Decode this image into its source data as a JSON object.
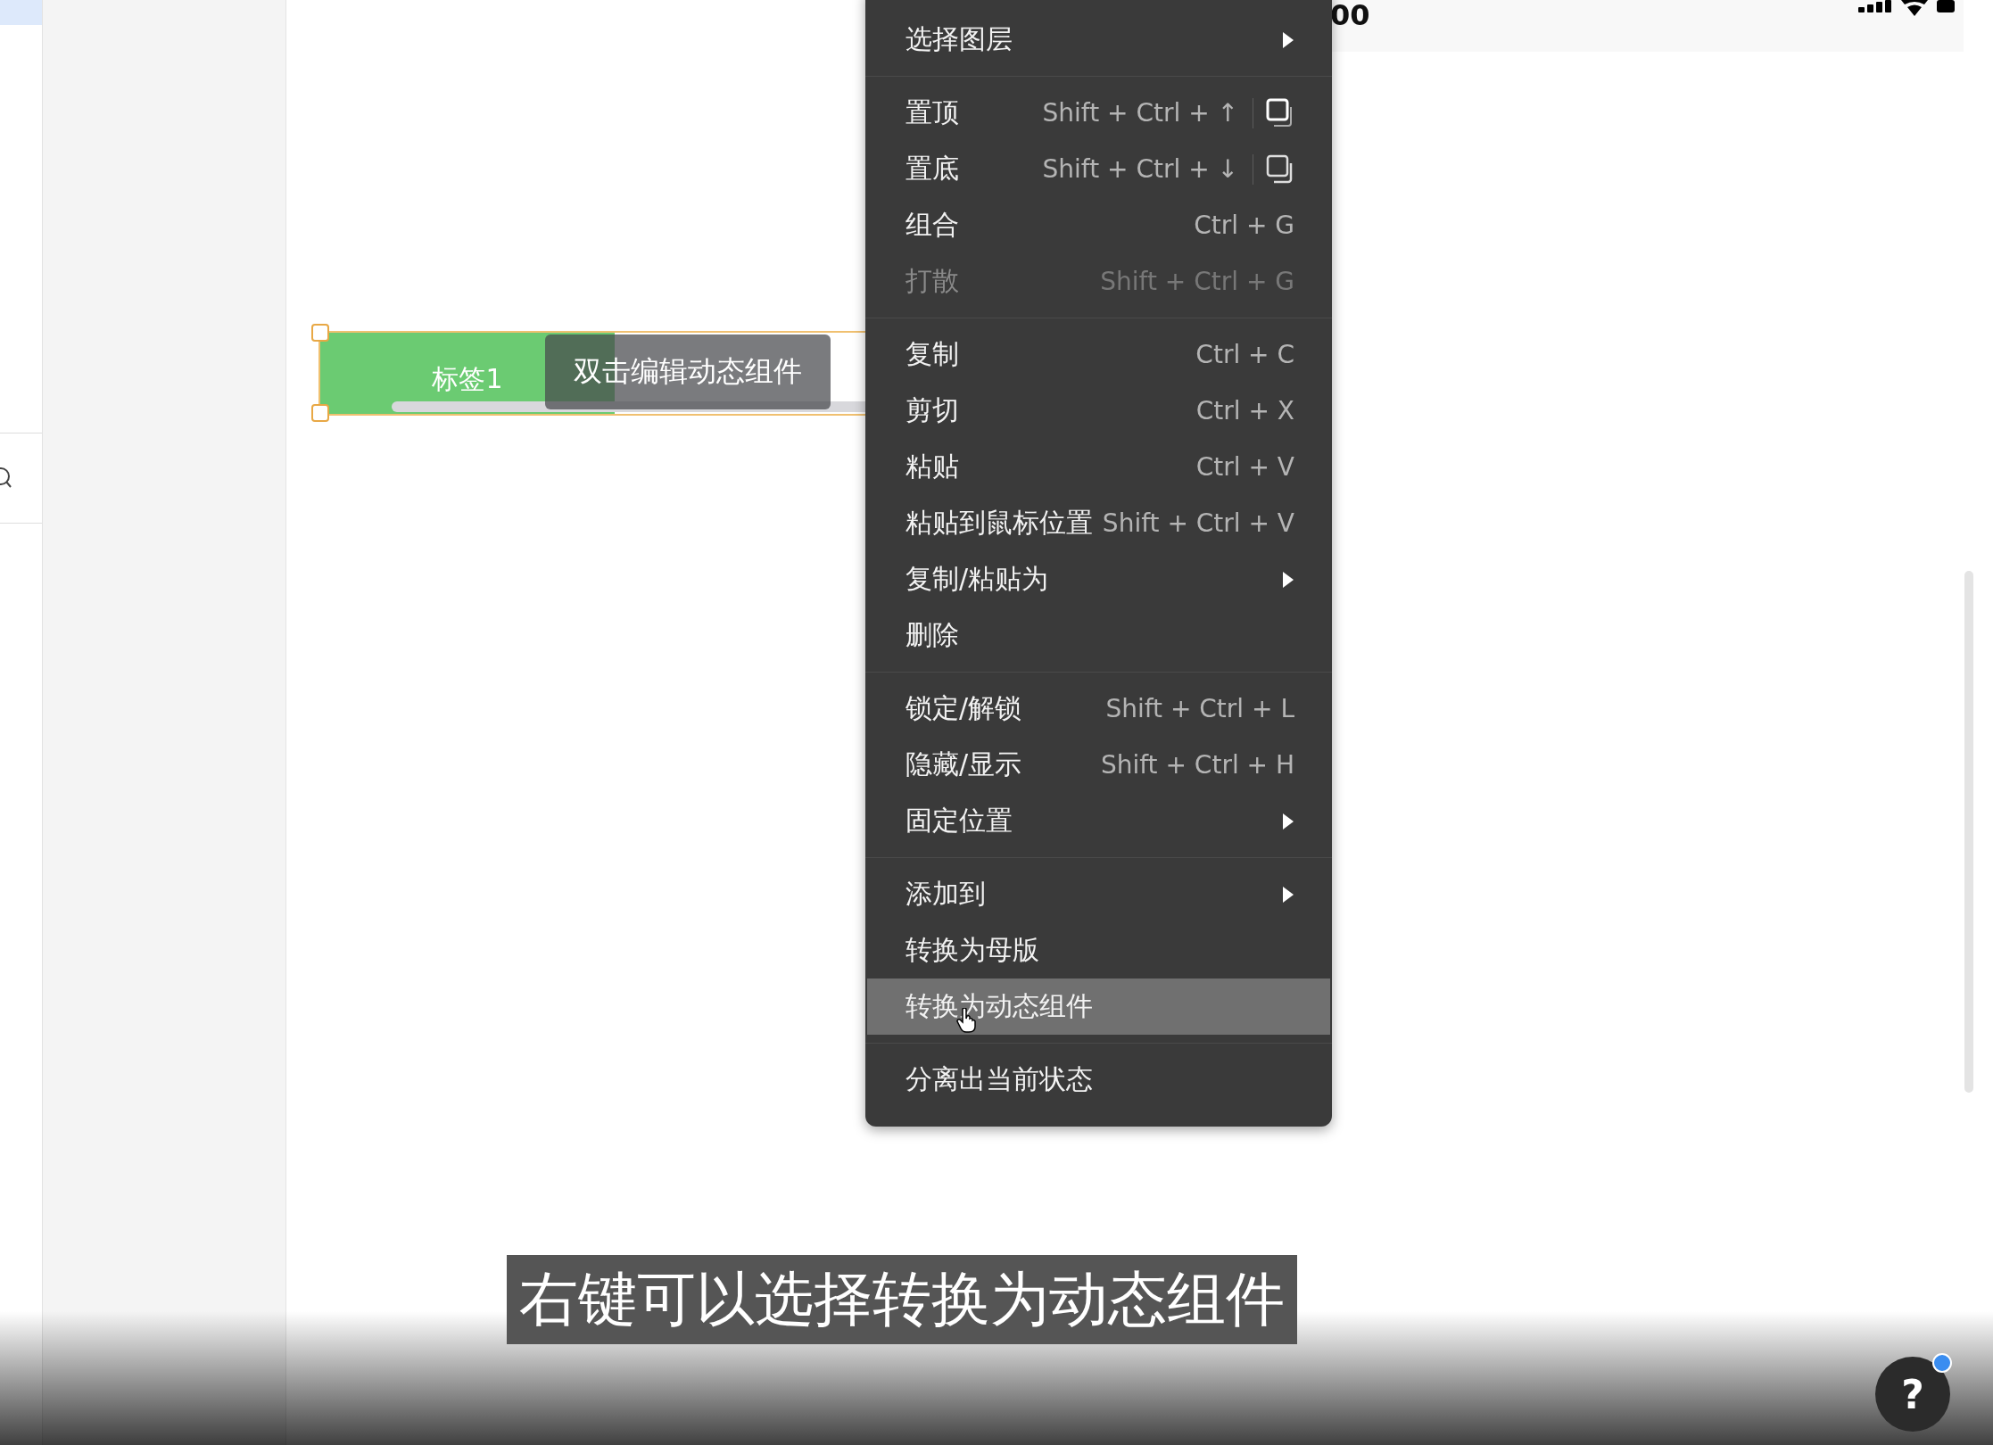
{
  "phone_status": {
    "time": "00"
  },
  "widget": {
    "tabs": [
      {
        "label": "标签1",
        "selected": true
      }
    ],
    "tooltip": "双击编辑动态组件",
    "selected": true
  },
  "context_menu": {
    "sections": [
      [
        {
          "kind": "submenu",
          "label": "选择图层",
          "disabled": false,
          "selected": false
        }
      ],
      [
        {
          "kind": "layer",
          "label": "置顶",
          "shortcut": "Shift + Ctrl + ↑",
          "disabled": false,
          "selected": false
        },
        {
          "kind": "layer",
          "label": "置底",
          "shortcut": "Shift + Ctrl + ↓",
          "disabled": false,
          "selected": false
        },
        {
          "kind": "shortcut",
          "label": "组合",
          "shortcut": "Ctrl + G",
          "disabled": false,
          "selected": false
        },
        {
          "kind": "shortcut",
          "label": "打散",
          "shortcut": "Shift + Ctrl + G",
          "disabled": true,
          "selected": false
        }
      ],
      [
        {
          "kind": "shortcut",
          "label": "复制",
          "shortcut": "Ctrl + C",
          "disabled": false,
          "selected": false
        },
        {
          "kind": "shortcut",
          "label": "剪切",
          "shortcut": "Ctrl + X",
          "disabled": false,
          "selected": false
        },
        {
          "kind": "shortcut",
          "label": "粘贴",
          "shortcut": "Ctrl + V",
          "disabled": false,
          "selected": false
        },
        {
          "kind": "shortcut",
          "label": "粘贴到鼠标位置",
          "shortcut": "Shift + Ctrl + V",
          "disabled": false,
          "selected": false
        },
        {
          "kind": "submenu",
          "label": "复制/粘贴为",
          "disabled": false,
          "selected": false
        },
        {
          "kind": "action",
          "label": "删除",
          "disabled": false,
          "selected": false
        }
      ],
      [
        {
          "kind": "shortcut",
          "label": "锁定/解锁",
          "shortcut": "Shift + Ctrl + L",
          "disabled": false,
          "selected": false
        },
        {
          "kind": "shortcut",
          "label": "隐藏/显示",
          "shortcut": "Shift + Ctrl + H",
          "disabled": false,
          "selected": false
        },
        {
          "kind": "submenu",
          "label": "固定位置",
          "disabled": false,
          "selected": false
        }
      ],
      [
        {
          "kind": "submenu",
          "label": "添加到",
          "disabled": false,
          "selected": false
        },
        {
          "kind": "action",
          "label": "转换为母版",
          "disabled": false,
          "selected": false
        },
        {
          "kind": "action",
          "label": "转换为动态组件",
          "disabled": false,
          "selected": true
        }
      ],
      [
        {
          "kind": "action",
          "label": "分离出当前状态",
          "disabled": false,
          "selected": false
        }
      ]
    ]
  },
  "caption": "右键可以选择转换为动态组件",
  "help_button": {
    "label": "?",
    "has_notification": true
  }
}
